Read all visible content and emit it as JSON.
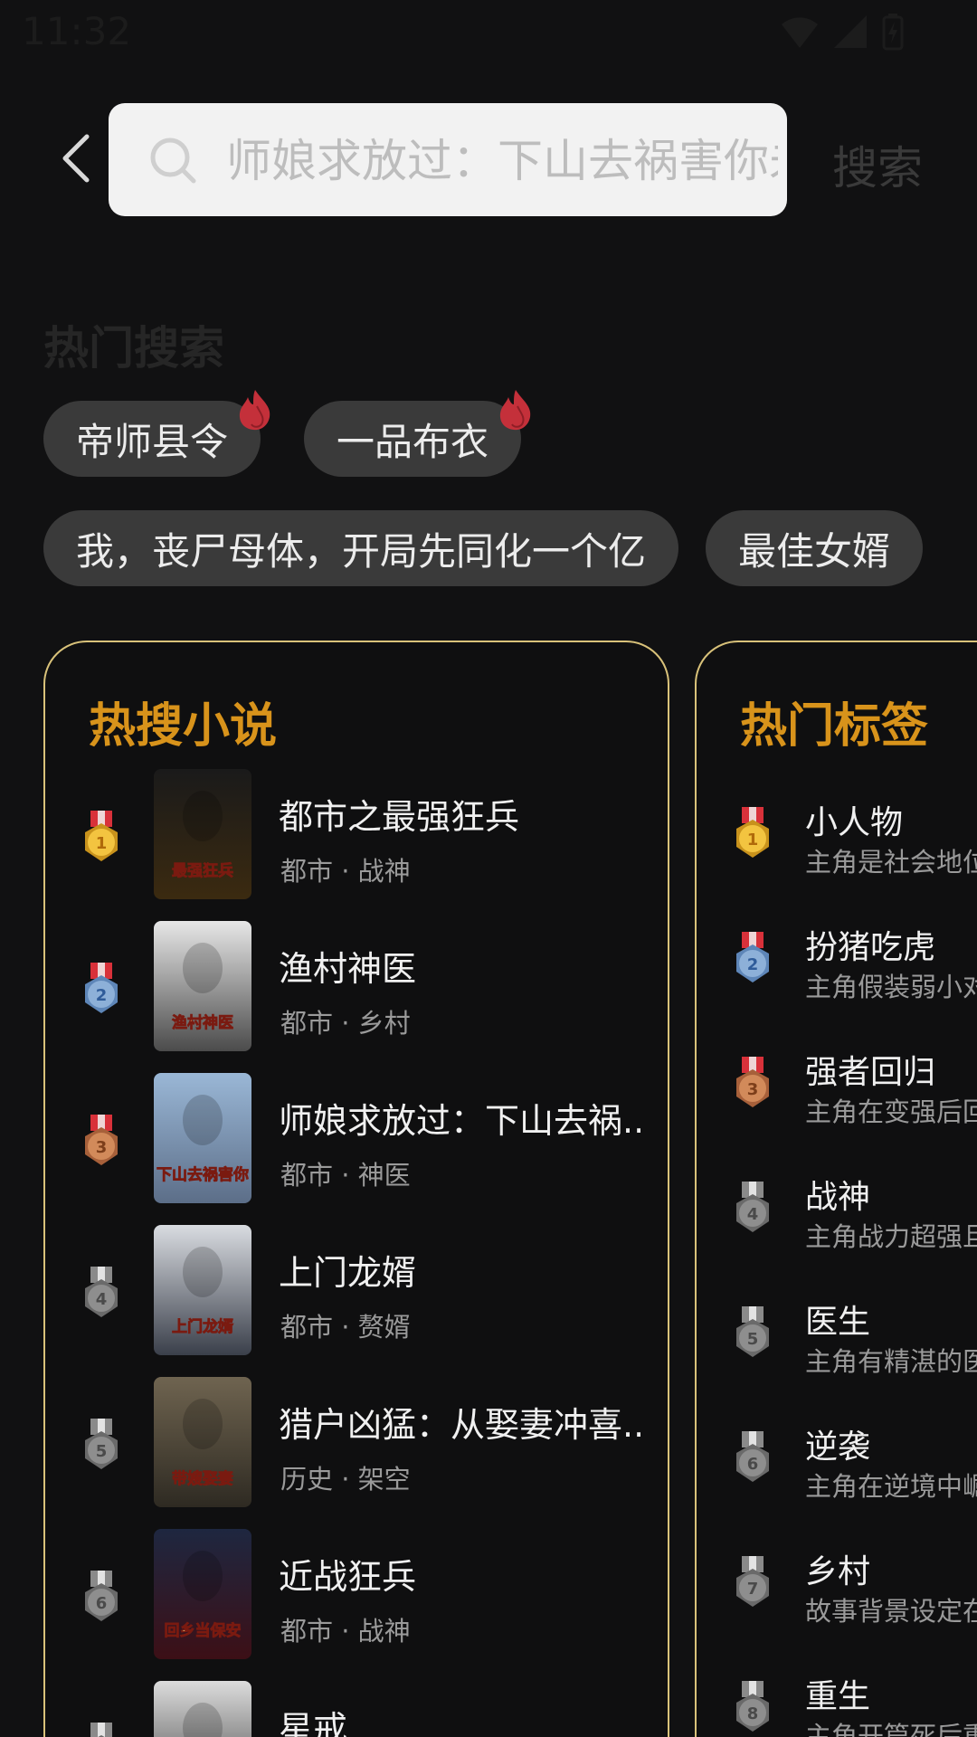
{
  "status_bar": {
    "time": "11:32",
    "icons": [
      "wifi-icon",
      "signal-icon",
      "battery-charging-icon"
    ]
  },
  "search": {
    "placeholder": "师娘求放过：下山去祸害你未婚妻吧",
    "button_label": "搜索"
  },
  "hot_search": {
    "title": "热门搜索",
    "chips": [
      {
        "label": "帝师县令",
        "hot": true
      },
      {
        "label": "一品布衣",
        "hot": true
      },
      {
        "label": "我，丧尸母体，开局先同化一个亿",
        "hot": false
      },
      {
        "label": "最佳女婿",
        "hot": false
      }
    ]
  },
  "hot_novels": {
    "title": "热搜小说",
    "items": [
      {
        "rank": "1",
        "title": "都市之最强狂兵",
        "meta": "都市 · 战神",
        "cover_text": "最强狂兵",
        "cover_colors": [
          "#1a1a1a",
          "#3b2a10"
        ],
        "medal": "gold"
      },
      {
        "rank": "2",
        "title": "渔村神医",
        "meta": "都市 · 乡村",
        "cover_text": "渔村神医",
        "cover_colors": [
          "#e7e7e7",
          "#4b4b4b"
        ],
        "medal": "silver"
      },
      {
        "rank": "3",
        "title": "师娘求放过：下山去祸...",
        "meta": "都市 · 神医",
        "cover_text": "下山去祸害你",
        "cover_colors": [
          "#9ab7d6",
          "#5c6e88"
        ],
        "medal": "bronze"
      },
      {
        "rank": "4",
        "title": "上门龙婿",
        "meta": "都市 · 赘婿",
        "cover_text": "上门龙婿",
        "cover_colors": [
          "#d9dce1",
          "#3a3f4a"
        ],
        "medal": "grey"
      },
      {
        "rank": "5",
        "title": "猎户凶猛：从娶妻冲喜...",
        "meta": "历史 · 架空",
        "cover_text": "带嫂娶妻",
        "cover_colors": [
          "#6f6450",
          "#2e2a22"
        ],
        "medal": "grey"
      },
      {
        "rank": "6",
        "title": "近战狂兵",
        "meta": "都市 · 战神",
        "cover_text": "回乡当保安",
        "cover_colors": [
          "#1e2740",
          "#3c0f16"
        ],
        "medal": "grey"
      },
      {
        "rank": "7",
        "title": "星戒",
        "meta": "",
        "cover_text": "",
        "cover_colors": [
          "#dcdcdc",
          "#333333"
        ],
        "medal": "grey"
      }
    ]
  },
  "hot_tags": {
    "title": "热门标签",
    "items": [
      {
        "rank": "1",
        "name": "小人物",
        "desc": "主角是社会地位",
        "medal": "gold"
      },
      {
        "rank": "2",
        "name": "扮猪吃虎",
        "desc": "主角假装弱小对",
        "medal": "silver"
      },
      {
        "rank": "3",
        "name": "强者回归",
        "desc": "主角在变强后回",
        "medal": "bronze"
      },
      {
        "rank": "4",
        "name": "战神",
        "desc": "主角战力超强且",
        "medal": "grey"
      },
      {
        "rank": "5",
        "name": "医生",
        "desc": "主角有精湛的医",
        "medal": "grey"
      },
      {
        "rank": "6",
        "name": "逆袭",
        "desc": "主角在逆境中崛",
        "medal": "grey"
      },
      {
        "rank": "7",
        "name": "乡村",
        "desc": "故事背景设定在",
        "medal": "grey"
      },
      {
        "rank": "8",
        "name": "重生",
        "desc": "主角开篇死后重",
        "medal": "grey"
      }
    ]
  },
  "colors": {
    "background": "#111112",
    "accent_title": "#d8931b",
    "card_border": "#d9c27a",
    "chip_bg": "#3a3a3a",
    "search_bg": "#f2f2f2"
  }
}
